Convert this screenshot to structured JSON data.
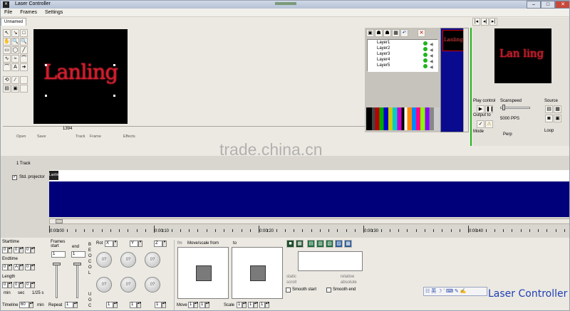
{
  "app": {
    "title": "Laser Controller"
  },
  "menu": [
    "File",
    "Frames",
    "Settings"
  ],
  "file_tab": "Unnamed",
  "canvas": {
    "text": "Lanling",
    "status_value": "1394"
  },
  "tools": [
    [
      "↖",
      "↘",
      "□"
    ],
    [
      "✋",
      "🔍",
      "🔍"
    ],
    [
      "▭",
      "◯",
      "╱"
    ],
    [
      "∿",
      "≈",
      "⌒"
    ],
    [
      "⌒",
      "A",
      "➔"
    ],
    [
      "⟲",
      "⁄",
      ""
    ],
    [
      "▤",
      "▣",
      ""
    ]
  ],
  "tool_labels": [
    "Open",
    "Save",
    "Track",
    "Frame",
    "Effects"
  ],
  "layers": [
    "Layer1",
    "Layer2",
    "Layer3",
    "Layer4",
    "Layer5"
  ],
  "thumb_text": "Lanling",
  "preview_text": "Lan ling",
  "play": {
    "play_control": "Play control",
    "scanspeed": "Scanspeed",
    "scanspeed_value": "5000 PPS",
    "output_to": "Output to",
    "mode": "Mode",
    "perp": "Perp",
    "source": "Source",
    "loop": "Loop"
  },
  "watermark": "trade.china.cn",
  "timeline": {
    "track_header": "1 Track",
    "track_name": "Std. projector",
    "clip_label": "Lanlin",
    "times": [
      "0:00:00",
      "0:00:10",
      "0:00:20",
      "0:00:30",
      "0:00:40"
    ]
  },
  "props": {
    "starttime": "Starttime",
    "endtime": "Endtime",
    "length": "Length",
    "min": "min",
    "sec": "sec",
    "fps": "1/25 s",
    "timeline": "Timeline",
    "timeline_value": "60",
    "timeline_unit": "min",
    "frames_start": "Frames start",
    "end": "end",
    "repeat": "Repeat",
    "repeat_value": "1",
    "v0": "0",
    "vA": "A",
    "v1": "1",
    "rot": "Rot",
    "rot_axes": [
      "X",
      "Y",
      "Z"
    ],
    "knob_value": "0?",
    "side_label_top": "B E O C O L",
    "side_label_bot": "U G C",
    "move_scale_from": "Move/scale from",
    "to": "to",
    "fm": "fm",
    "move": "Move",
    "scale": "Scale",
    "static": "static",
    "scroll": "scroll",
    "relative": "relative",
    "absolute": "absolute",
    "smooth_start": "Smooth start",
    "smooth_end": "Smooth end"
  },
  "logo": "Laser Controller",
  "colors": {
    "canvas": "#000000",
    "track": "#00007a",
    "layer_panel": "#0a0a8e",
    "accent_green": "#1db51d"
  }
}
